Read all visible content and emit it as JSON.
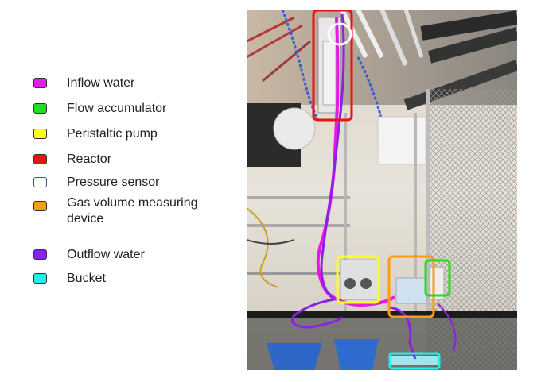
{
  "legend": {
    "items": [
      {
        "id": "inflow-water",
        "label": "Inflow water",
        "color": "#e619e6",
        "outline_only": false
      },
      {
        "id": "flow-accumulator",
        "label": "Flow accumulator",
        "color": "#22dd22",
        "outline_only": false
      },
      {
        "id": "peristaltic-pump",
        "label": "Peristaltic pump",
        "color": "#ffff22",
        "outline_only": false
      },
      {
        "id": "reactor",
        "label": "Reactor",
        "color": "#ee1111",
        "outline_only": false
      },
      {
        "id": "pressure-sensor",
        "label": "Pressure sensor",
        "color": "#ffffff",
        "outline_only": true
      },
      {
        "id": "gas-volume-device",
        "label": "Gas volume measuring device",
        "color": "#ff9a11",
        "outline_only": false
      },
      {
        "id": "outflow-water",
        "label": "Outflow water",
        "color": "#8a22e6",
        "outline_only": false
      },
      {
        "id": "bucket",
        "label": "Bucket",
        "color": "#22eeee",
        "outline_only": false
      }
    ]
  },
  "photo": {
    "colors": {
      "inflow": "#e619e6",
      "outflow": "#8a22e6",
      "reactor": "#ee1111",
      "pressure": "#ffffff",
      "pump": "#ffff22",
      "gas": "#ff9a11",
      "accumulator": "#22dd22",
      "bucket": "#22eeee"
    }
  }
}
